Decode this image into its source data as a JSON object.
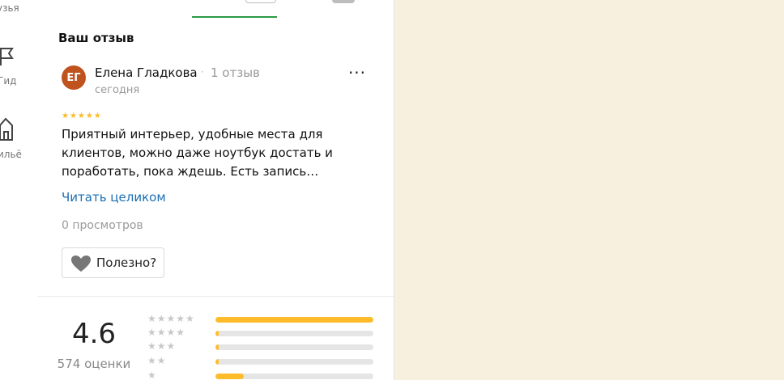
{
  "rail": {
    "items": [
      {
        "label": "узья"
      },
      {
        "label": "Гид"
      },
      {
        "label": "ильё"
      }
    ]
  },
  "review": {
    "section_title": "Ваш отзыв",
    "avatar_initials": "ЕГ",
    "avatar_color": "#c0521e",
    "author": "Елена Гладкова",
    "separator": "·",
    "reviews_count": "1 отзыв",
    "date": "сегодня",
    "more_menu": "···",
    "stars": "★★★★★",
    "rating": 5,
    "text": "Приятный интерьер, удобные места для клиентов, можно даже ноутбук достать и поработать, пока ждешь. Есть запись…",
    "read_more": "Читать целиком",
    "views": "0 просмотров",
    "useful_label": "Полезно?"
  },
  "summary": {
    "rating_value": "4.6",
    "rating_count": "574 оценки",
    "distribution": [
      {
        "stars": "★★★★★",
        "fraction": 1.0
      },
      {
        "stars": "★★★★",
        "fraction": 0.02
      },
      {
        "stars": "★★★",
        "fraction": 0.02
      },
      {
        "stars": "★★",
        "fraction": 0.02
      },
      {
        "stars": "★",
        "fraction": 0.18
      }
    ]
  },
  "colors": {
    "accent_green": "#2e9a44",
    "link_blue": "#1a6eb5",
    "star_yellow": "#ffbb22",
    "map_background": "#f8f0de"
  }
}
